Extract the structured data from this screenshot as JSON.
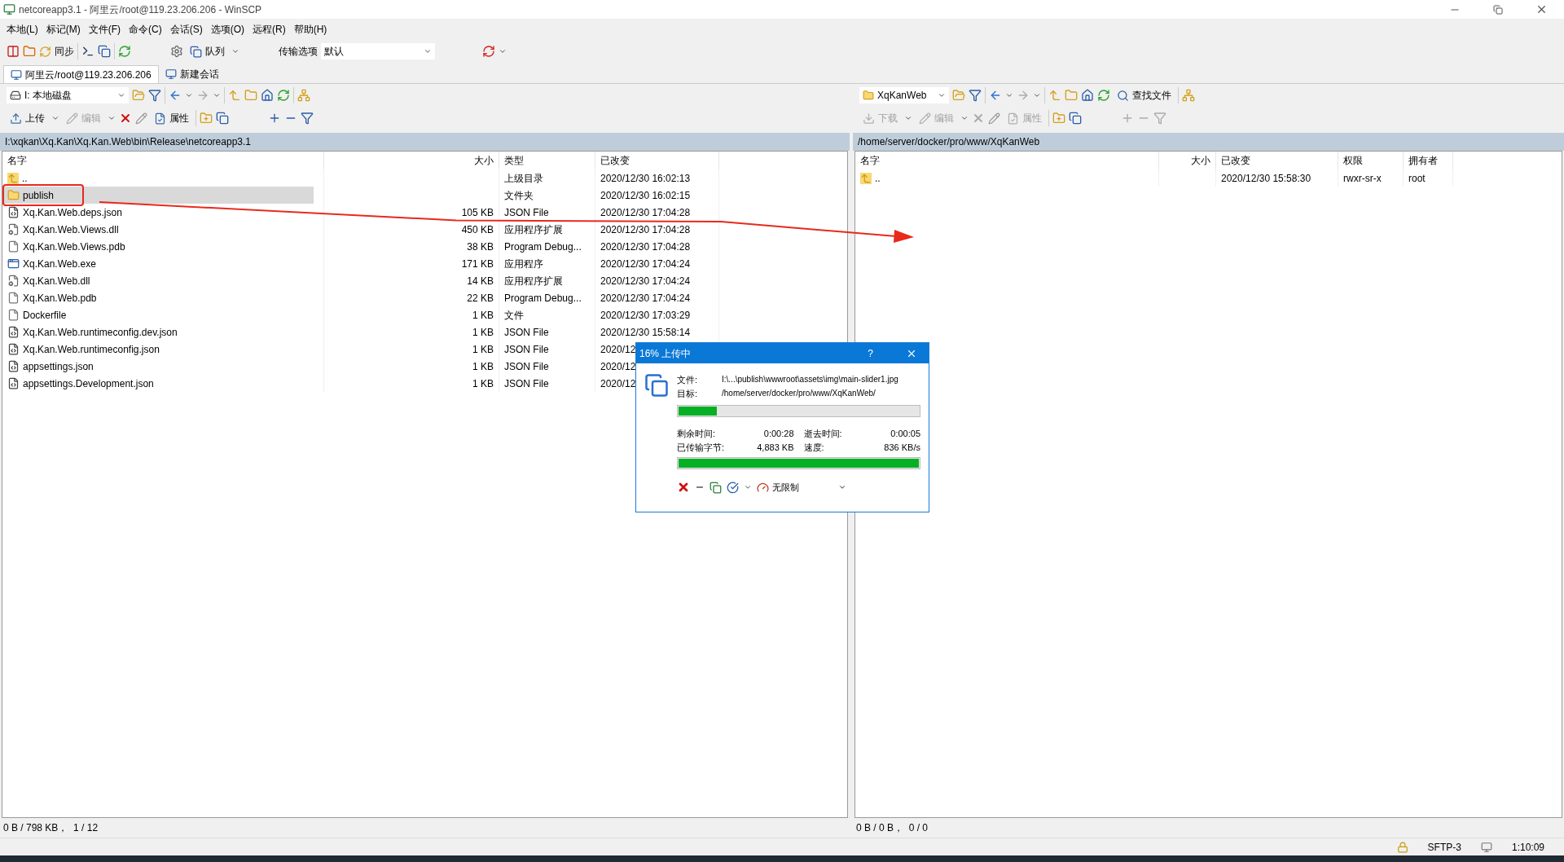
{
  "window": {
    "title": "netcoreapp3.1 - 阿里云/root@119.23.206.206 - WinSCP"
  },
  "menu": [
    "本地(L)",
    "标记(M)",
    "文件(F)",
    "命令(C)",
    "会话(S)",
    "选项(O)",
    "远程(R)",
    "帮助(H)"
  ],
  "toolbar": {
    "sync_label": "同步",
    "queue_label": "队列",
    "transfer_options_label": "传输选项",
    "transfer_options_value": "默认"
  },
  "session_tabs": [
    {
      "label": "阿里云/root@119.23.206.206",
      "selected": true
    },
    {
      "label": "新建会话",
      "selected": false
    }
  ],
  "local": {
    "drive": "I: 本地磁盘",
    "buttons": [
      {
        "label": "上传",
        "disabled": false
      },
      {
        "label": "编辑",
        "disabled": true
      },
      {
        "label": "属性",
        "disabled": false
      }
    ],
    "path": "I:\\xqkan\\Xq.Kan\\Xq.Kan.Web\\bin\\Release\\netcoreapp3.1",
    "columns": [
      "名字",
      "大小",
      "类型",
      "已改变"
    ],
    "rows": [
      {
        "kind": "parent",
        "name": "..",
        "type": "上级目录",
        "changed": "2020/12/30  16:02:13",
        "selected": false
      },
      {
        "kind": "folder",
        "name": "publish",
        "type": "文件夹",
        "changed": "2020/12/30  16:02:15",
        "selected": true
      },
      {
        "kind": "script",
        "name": "Xq.Kan.Web.deps.json",
        "size": "105 KB",
        "type": "JSON File",
        "changed": "2020/12/30  17:04:28",
        "selected": false
      },
      {
        "kind": "library",
        "name": "Xq.Kan.Web.Views.dll",
        "size": "450 KB",
        "type": "应用程序扩展",
        "changed": "2020/12/30  17:04:28",
        "selected": false
      },
      {
        "kind": "file",
        "name": "Xq.Kan.Web.Views.pdb",
        "size": "38 KB",
        "type": "Program Debug...",
        "changed": "2020/12/30  17:04:28",
        "selected": false
      },
      {
        "kind": "program",
        "name": "Xq.Kan.Web.exe",
        "size": "171 KB",
        "type": "应用程序",
        "changed": "2020/12/30  17:04:24",
        "selected": false
      },
      {
        "kind": "library",
        "name": "Xq.Kan.Web.dll",
        "size": "14 KB",
        "type": "应用程序扩展",
        "changed": "2020/12/30  17:04:24",
        "selected": false
      },
      {
        "kind": "file",
        "name": "Xq.Kan.Web.pdb",
        "size": "22 KB",
        "type": "Program Debug...",
        "changed": "2020/12/30  17:04:24",
        "selected": false
      },
      {
        "kind": "file",
        "name": "Dockerfile",
        "size": "1 KB",
        "type": "文件",
        "changed": "2020/12/30  17:03:29",
        "selected": false
      },
      {
        "kind": "script",
        "name": "Xq.Kan.Web.runtimeconfig.dev.json",
        "size": "1 KB",
        "type": "JSON File",
        "changed": "2020/12/30  15:58:14",
        "selected": false
      },
      {
        "kind": "script",
        "name": "Xq.Kan.Web.runtimeconfig.json",
        "size": "1 KB",
        "type": "JSON File",
        "changed": "2020/12",
        "selected": false
      },
      {
        "kind": "script",
        "name": "appsettings.json",
        "size": "1 KB",
        "type": "JSON File",
        "changed": "2020/12",
        "selected": false
      },
      {
        "kind": "script",
        "name": "appsettings.Development.json",
        "size": "1 KB",
        "type": "JSON File",
        "changed": "2020/12",
        "selected": false
      }
    ],
    "status": "0 B / 798 KB，  1 / 12"
  },
  "remote": {
    "folder": "XqKanWeb",
    "find_label": "查找文件",
    "buttons": [
      {
        "label": "下载",
        "disabled": true
      },
      {
        "label": "编辑",
        "disabled": true
      },
      {
        "label": "属性",
        "disabled": true
      }
    ],
    "path": "/home/server/docker/pro/www/XqKanWeb",
    "columns": [
      "名字",
      "大小",
      "已改变",
      "权限",
      "拥有者"
    ],
    "rows": [
      {
        "kind": "parent",
        "name": "..",
        "changed": "2020/12/30 15:58:30",
        "rights": "rwxr-sr-x",
        "owner": "root",
        "selected": false
      }
    ],
    "status": "0 B / 0 B，  0 / 0"
  },
  "status_bar": {
    "protocol": "SFTP-3",
    "time": "1:10:09"
  },
  "dialog": {
    "title": "16% 上传中",
    "help": "?",
    "file_label": "文件:",
    "file_value": "I:\\...\\publish\\wwwroot\\assets\\img\\main-slider1.jpg",
    "target_label": "目标:",
    "target_value": "/home/server/docker/pro/www/XqKanWeb/",
    "file_progress": {
      "level": 0.16
    },
    "stats": [
      {
        "label": "剩余时间:",
        "value": "0:00:28"
      },
      {
        "label": "逝去时间:",
        "value": "0:00:05"
      },
      {
        "label": "已传输字节:",
        "value": "4,883 KB"
      },
      {
        "label": "速度:",
        "value": "836 KB/s"
      }
    ],
    "total_progress": {
      "level": 1
    },
    "speed_limit": "无限制"
  }
}
